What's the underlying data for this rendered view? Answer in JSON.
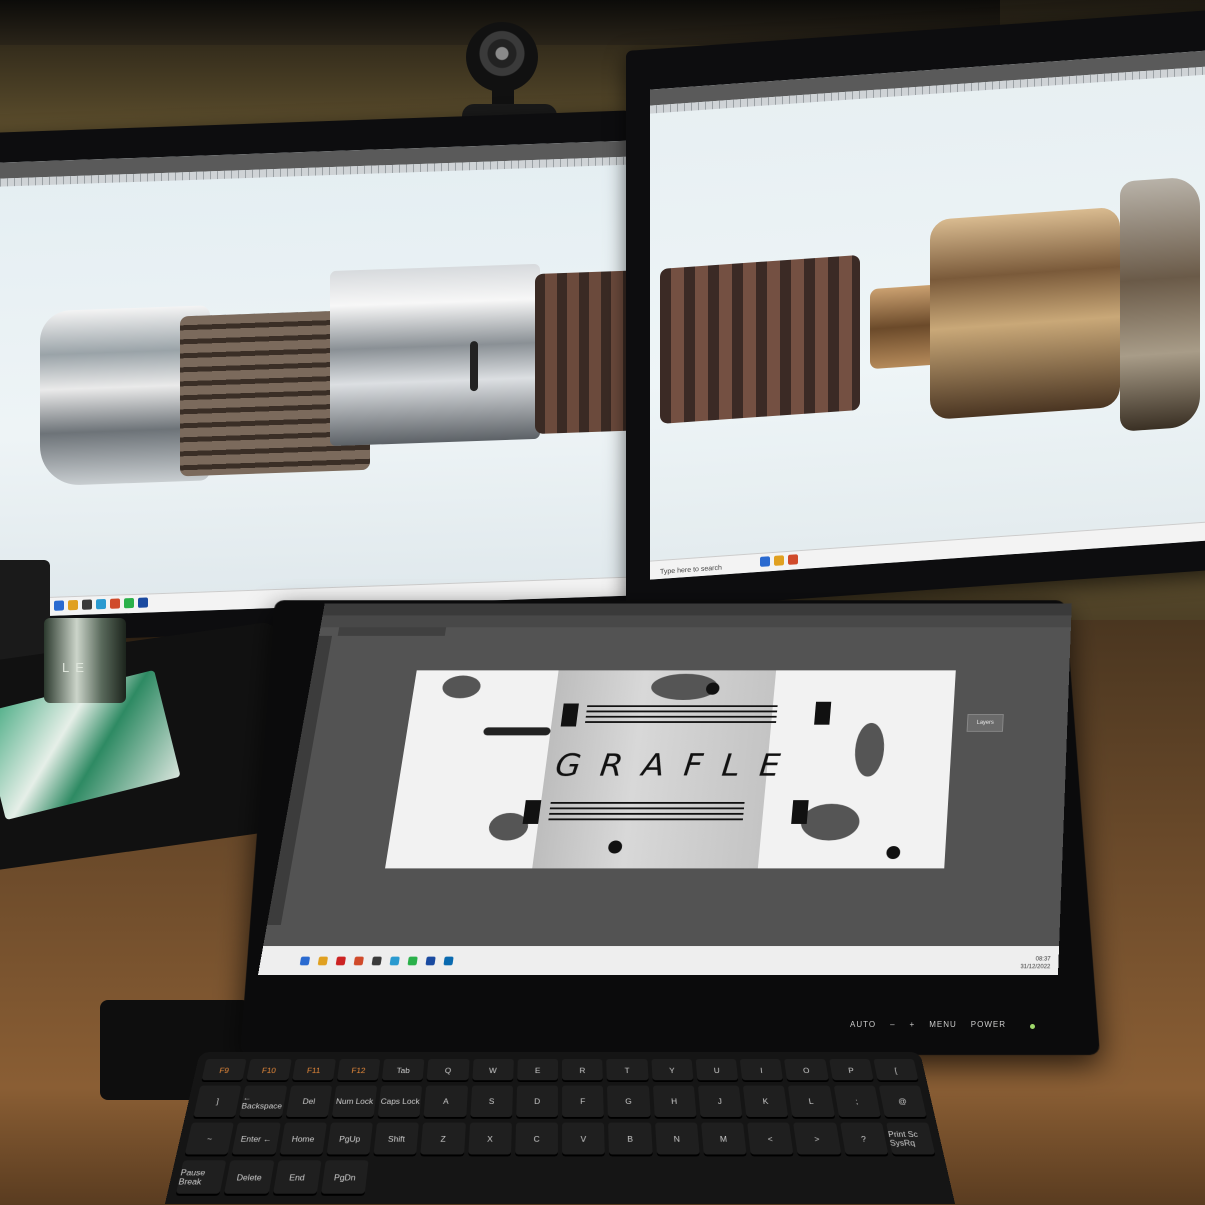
{
  "scene": "Photo of a desk with two monitors and a drawing tablet running Photoshop",
  "tablet_canvas": {
    "logo_text": "GRAFLE",
    "layers_panel_label": "Layers"
  },
  "tablet_controls": {
    "auto": "AUTO",
    "minus": "–",
    "plus": "+",
    "menu": "MENU",
    "power": "POWER"
  },
  "right_monitor": {
    "taskbar_search": "Type here to search"
  },
  "tablet_screen": {
    "clock_time": "08:37",
    "clock_date": "31/12/2022"
  },
  "cup": {
    "label": "LE"
  },
  "keyboard": {
    "keys": [
      {
        "label": "Tab"
      },
      {
        "label": "Q"
      },
      {
        "label": "W"
      },
      {
        "label": "E"
      },
      {
        "label": "R"
      },
      {
        "label": "T"
      },
      {
        "label": "Y"
      },
      {
        "label": "U"
      },
      {
        "label": "I"
      },
      {
        "label": "O"
      },
      {
        "label": "P"
      },
      {
        "label": "["
      },
      {
        "label": "]"
      },
      {
        "label": "← Backspace"
      },
      {
        "label": "Del"
      },
      {
        "label": "Num Lock"
      },
      {
        "label": "Caps Lock"
      },
      {
        "label": "A"
      },
      {
        "label": "S"
      },
      {
        "label": "D"
      },
      {
        "label": "F"
      },
      {
        "label": "G"
      },
      {
        "label": "H"
      },
      {
        "label": "J"
      },
      {
        "label": "K"
      },
      {
        "label": "L"
      },
      {
        "label": ";"
      },
      {
        "label": "@"
      },
      {
        "label": "~"
      },
      {
        "label": "Enter ←"
      },
      {
        "label": "Home"
      },
      {
        "label": "PgUp"
      },
      {
        "label": "Shift"
      },
      {
        "label": "Z"
      },
      {
        "label": "X"
      },
      {
        "label": "C"
      },
      {
        "label": "V"
      },
      {
        "label": "B"
      },
      {
        "label": "N"
      },
      {
        "label": "M"
      },
      {
        "label": "<"
      },
      {
        "label": ">"
      },
      {
        "label": "?"
      },
      {
        "label": "Print Sc SysRq"
      },
      {
        "label": "Pause Break"
      },
      {
        "label": "Delete"
      },
      {
        "label": "End"
      },
      {
        "label": "PgDn"
      }
    ],
    "fkeys": [
      "F9",
      "F10",
      "F11",
      "F12"
    ]
  },
  "colors": {
    "wall": "#7a6a40",
    "desk": "#8a5e34",
    "ps_bg": "#535353",
    "canvas": "#f2f2f2",
    "logo": "#111111"
  }
}
